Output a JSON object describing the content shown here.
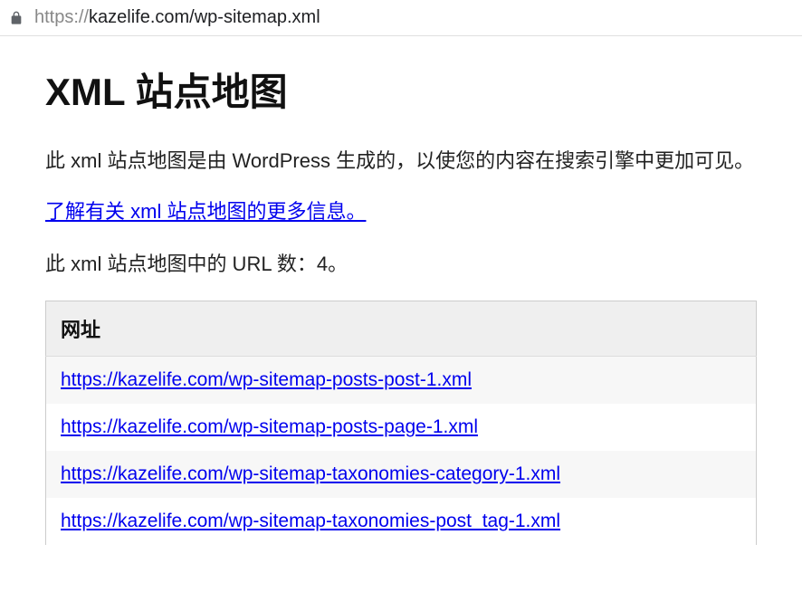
{
  "address_bar": {
    "url_scheme": "https://",
    "url_rest": "kazelife.com/wp-sitemap.xml"
  },
  "page": {
    "title": "XML 站点地图",
    "intro": "此 xml 站点地图是由 WordPress 生成的，以使您的内容在搜索引擎中更加可见。",
    "learn_more": "了解有关 xml 站点地图的更多信息。",
    "count_prefix": "此 xml 站点地图中的 URL 数：",
    "count_value": "4。"
  },
  "table": {
    "header": "网址",
    "rows": [
      "https://kazelife.com/wp-sitemap-posts-post-1.xml",
      "https://kazelife.com/wp-sitemap-posts-page-1.xml",
      "https://kazelife.com/wp-sitemap-taxonomies-category-1.xml",
      "https://kazelife.com/wp-sitemap-taxonomies-post_tag-1.xml"
    ]
  }
}
